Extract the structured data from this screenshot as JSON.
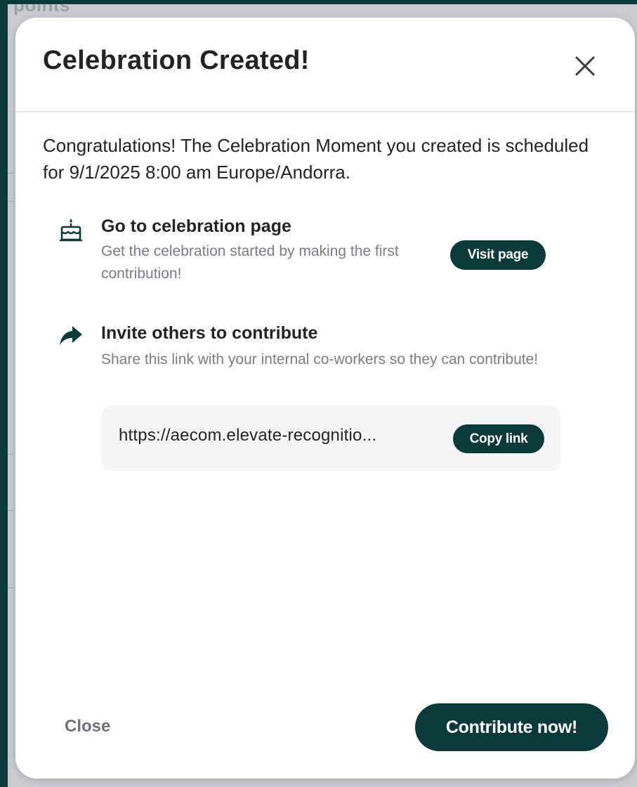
{
  "background": {
    "partial_text": "points"
  },
  "modal": {
    "title": "Celebration Created!",
    "intro": "Congratulations! The Celebration Moment you created is scheduled for 9/1/2025 8:00 am Europe/Andorra.",
    "celebration_page": {
      "icon": "cake-icon",
      "title": "Go to celebration page",
      "description": "Get the celebration started by making the first contribution!",
      "button_label": "Visit page"
    },
    "invite": {
      "icon": "share-arrow-icon",
      "title": "Invite others to contribute",
      "description": "Share this link with your internal co-workers so they can contribute!",
      "link": "https://aecom.elevate-recognitio...",
      "copy_label": "Copy link"
    },
    "footer": {
      "close_label": "Close",
      "contribute_label": "Contribute now!"
    }
  },
  "colors": {
    "accent": "#0c3a3c",
    "frame": "#0c3a3c",
    "text_primary": "#232325",
    "text_secondary": "#7a7c82",
    "link_box_bg": "#f4f5f7",
    "backdrop": "#c9cbcf"
  }
}
